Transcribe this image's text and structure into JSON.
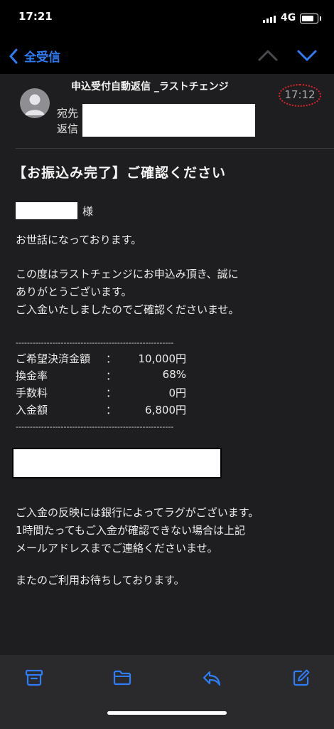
{
  "status": {
    "time": "17:21",
    "network": "4G"
  },
  "nav": {
    "back_label": "全受信"
  },
  "mail": {
    "subject": "申込受付自動返信 _ラストチェンジ",
    "received_time": "17:12",
    "to_label": "宛先",
    "reply_label": "返信"
  },
  "body": {
    "title": "【お振込み完了】ご確認ください",
    "honorific": "様",
    "greeting": "お世話になっております。",
    "thanks_line1": "この度はラストチェンジにお申込み頂き、誠に",
    "thanks_line2": "ありがとうございます。",
    "thanks_line3": "ご入金いたしましたのでご確認くださいませ。",
    "divider": "--------------------------------------------------------",
    "payment": [
      {
        "label": "ご希望決済金額",
        "colon": "：",
        "value": "10,000円"
      },
      {
        "label": "換金率",
        "colon": "：",
        "value": "68%"
      },
      {
        "label": "手数料",
        "colon": "：",
        "value": "0円"
      },
      {
        "label": "入金額",
        "colon": "：",
        "value": "6,800円"
      }
    ],
    "notice_line1": "ご入金の反映には銀行によってラグがございます。",
    "notice_line2": "1時間たってもご入金が確認できない場合は上記",
    "notice_line3": "メールアドレスまでご連絡くださいませ。",
    "closing": "またのご利用お待ちしております。"
  },
  "colors": {
    "accent": "#2f7cf6",
    "highlight_circle": "#d8232a",
    "background": "#1e1e20"
  },
  "toolbar_icons": [
    "archive-icon",
    "folder-icon",
    "reply-icon",
    "compose-icon"
  ]
}
